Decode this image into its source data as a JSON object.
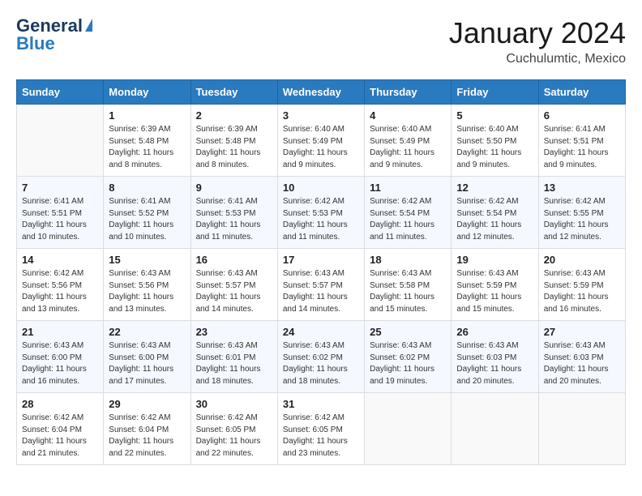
{
  "header": {
    "logo_line1": "General",
    "logo_line2": "Blue",
    "month_title": "January 2024",
    "location": "Cuchulumtic, Mexico"
  },
  "weekdays": [
    "Sunday",
    "Monday",
    "Tuesday",
    "Wednesday",
    "Thursday",
    "Friday",
    "Saturday"
  ],
  "weeks": [
    [
      {
        "day": "",
        "sunrise": "",
        "sunset": "",
        "daylight": ""
      },
      {
        "day": "1",
        "sunrise": "Sunrise: 6:39 AM",
        "sunset": "Sunset: 5:48 PM",
        "daylight": "Daylight: 11 hours and 8 minutes."
      },
      {
        "day": "2",
        "sunrise": "Sunrise: 6:39 AM",
        "sunset": "Sunset: 5:48 PM",
        "daylight": "Daylight: 11 hours and 8 minutes."
      },
      {
        "day": "3",
        "sunrise": "Sunrise: 6:40 AM",
        "sunset": "Sunset: 5:49 PM",
        "daylight": "Daylight: 11 hours and 9 minutes."
      },
      {
        "day": "4",
        "sunrise": "Sunrise: 6:40 AM",
        "sunset": "Sunset: 5:49 PM",
        "daylight": "Daylight: 11 hours and 9 minutes."
      },
      {
        "day": "5",
        "sunrise": "Sunrise: 6:40 AM",
        "sunset": "Sunset: 5:50 PM",
        "daylight": "Daylight: 11 hours and 9 minutes."
      },
      {
        "day": "6",
        "sunrise": "Sunrise: 6:41 AM",
        "sunset": "Sunset: 5:51 PM",
        "daylight": "Daylight: 11 hours and 9 minutes."
      }
    ],
    [
      {
        "day": "7",
        "sunrise": "Sunrise: 6:41 AM",
        "sunset": "Sunset: 5:51 PM",
        "daylight": "Daylight: 11 hours and 10 minutes."
      },
      {
        "day": "8",
        "sunrise": "Sunrise: 6:41 AM",
        "sunset": "Sunset: 5:52 PM",
        "daylight": "Daylight: 11 hours and 10 minutes."
      },
      {
        "day": "9",
        "sunrise": "Sunrise: 6:41 AM",
        "sunset": "Sunset: 5:53 PM",
        "daylight": "Daylight: 11 hours and 11 minutes."
      },
      {
        "day": "10",
        "sunrise": "Sunrise: 6:42 AM",
        "sunset": "Sunset: 5:53 PM",
        "daylight": "Daylight: 11 hours and 11 minutes."
      },
      {
        "day": "11",
        "sunrise": "Sunrise: 6:42 AM",
        "sunset": "Sunset: 5:54 PM",
        "daylight": "Daylight: 11 hours and 11 minutes."
      },
      {
        "day": "12",
        "sunrise": "Sunrise: 6:42 AM",
        "sunset": "Sunset: 5:54 PM",
        "daylight": "Daylight: 11 hours and 12 minutes."
      },
      {
        "day": "13",
        "sunrise": "Sunrise: 6:42 AM",
        "sunset": "Sunset: 5:55 PM",
        "daylight": "Daylight: 11 hours and 12 minutes."
      }
    ],
    [
      {
        "day": "14",
        "sunrise": "Sunrise: 6:42 AM",
        "sunset": "Sunset: 5:56 PM",
        "daylight": "Daylight: 11 hours and 13 minutes."
      },
      {
        "day": "15",
        "sunrise": "Sunrise: 6:43 AM",
        "sunset": "Sunset: 5:56 PM",
        "daylight": "Daylight: 11 hours and 13 minutes."
      },
      {
        "day": "16",
        "sunrise": "Sunrise: 6:43 AM",
        "sunset": "Sunset: 5:57 PM",
        "daylight": "Daylight: 11 hours and 14 minutes."
      },
      {
        "day": "17",
        "sunrise": "Sunrise: 6:43 AM",
        "sunset": "Sunset: 5:57 PM",
        "daylight": "Daylight: 11 hours and 14 minutes."
      },
      {
        "day": "18",
        "sunrise": "Sunrise: 6:43 AM",
        "sunset": "Sunset: 5:58 PM",
        "daylight": "Daylight: 11 hours and 15 minutes."
      },
      {
        "day": "19",
        "sunrise": "Sunrise: 6:43 AM",
        "sunset": "Sunset: 5:59 PM",
        "daylight": "Daylight: 11 hours and 15 minutes."
      },
      {
        "day": "20",
        "sunrise": "Sunrise: 6:43 AM",
        "sunset": "Sunset: 5:59 PM",
        "daylight": "Daylight: 11 hours and 16 minutes."
      }
    ],
    [
      {
        "day": "21",
        "sunrise": "Sunrise: 6:43 AM",
        "sunset": "Sunset: 6:00 PM",
        "daylight": "Daylight: 11 hours and 16 minutes."
      },
      {
        "day": "22",
        "sunrise": "Sunrise: 6:43 AM",
        "sunset": "Sunset: 6:00 PM",
        "daylight": "Daylight: 11 hours and 17 minutes."
      },
      {
        "day": "23",
        "sunrise": "Sunrise: 6:43 AM",
        "sunset": "Sunset: 6:01 PM",
        "daylight": "Daylight: 11 hours and 18 minutes."
      },
      {
        "day": "24",
        "sunrise": "Sunrise: 6:43 AM",
        "sunset": "Sunset: 6:02 PM",
        "daylight": "Daylight: 11 hours and 18 minutes."
      },
      {
        "day": "25",
        "sunrise": "Sunrise: 6:43 AM",
        "sunset": "Sunset: 6:02 PM",
        "daylight": "Daylight: 11 hours and 19 minutes."
      },
      {
        "day": "26",
        "sunrise": "Sunrise: 6:43 AM",
        "sunset": "Sunset: 6:03 PM",
        "daylight": "Daylight: 11 hours and 20 minutes."
      },
      {
        "day": "27",
        "sunrise": "Sunrise: 6:43 AM",
        "sunset": "Sunset: 6:03 PM",
        "daylight": "Daylight: 11 hours and 20 minutes."
      }
    ],
    [
      {
        "day": "28",
        "sunrise": "Sunrise: 6:42 AM",
        "sunset": "Sunset: 6:04 PM",
        "daylight": "Daylight: 11 hours and 21 minutes."
      },
      {
        "day": "29",
        "sunrise": "Sunrise: 6:42 AM",
        "sunset": "Sunset: 6:04 PM",
        "daylight": "Daylight: 11 hours and 22 minutes."
      },
      {
        "day": "30",
        "sunrise": "Sunrise: 6:42 AM",
        "sunset": "Sunset: 6:05 PM",
        "daylight": "Daylight: 11 hours and 22 minutes."
      },
      {
        "day": "31",
        "sunrise": "Sunrise: 6:42 AM",
        "sunset": "Sunset: 6:05 PM",
        "daylight": "Daylight: 11 hours and 23 minutes."
      },
      {
        "day": "",
        "sunrise": "",
        "sunset": "",
        "daylight": ""
      },
      {
        "day": "",
        "sunrise": "",
        "sunset": "",
        "daylight": ""
      },
      {
        "day": "",
        "sunrise": "",
        "sunset": "",
        "daylight": ""
      }
    ]
  ]
}
